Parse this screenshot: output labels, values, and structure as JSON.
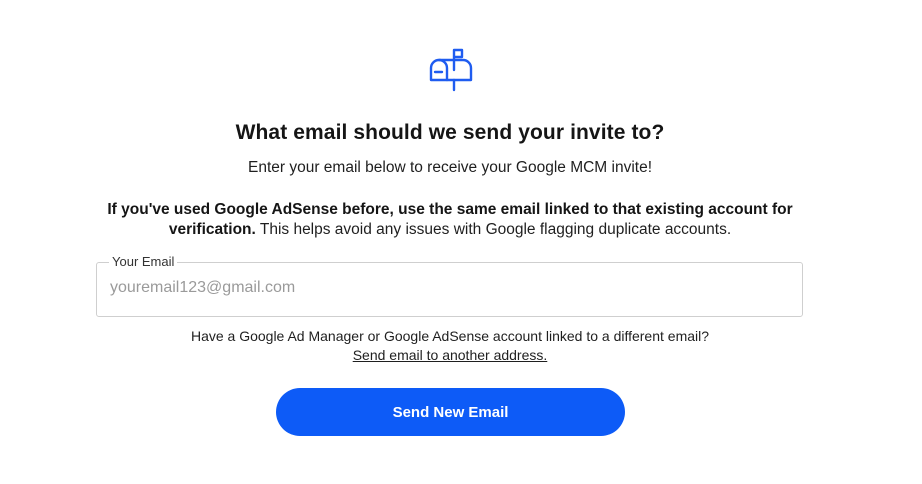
{
  "header": {
    "icon": "mailbox-icon",
    "title": "What email should we send your invite to?",
    "subtitle": "Enter your email below to receive your Google MCM invite!"
  },
  "note": {
    "bold": "If you've used Google AdSense before, use the same email linked to that existing account for verification.",
    "regular": " This helps avoid any issues with Google flagging duplicate accounts."
  },
  "email_field": {
    "label": "Your Email",
    "placeholder": "youremail123@gmail.com",
    "value": ""
  },
  "alternate": {
    "question": "Have a Google Ad Manager or Google AdSense account linked to a different email?",
    "link": "Send email to another address."
  },
  "actions": {
    "send_label": "Send New Email"
  },
  "colors": {
    "accent": "#0d5bf7",
    "icon": "#1f5cf0"
  }
}
